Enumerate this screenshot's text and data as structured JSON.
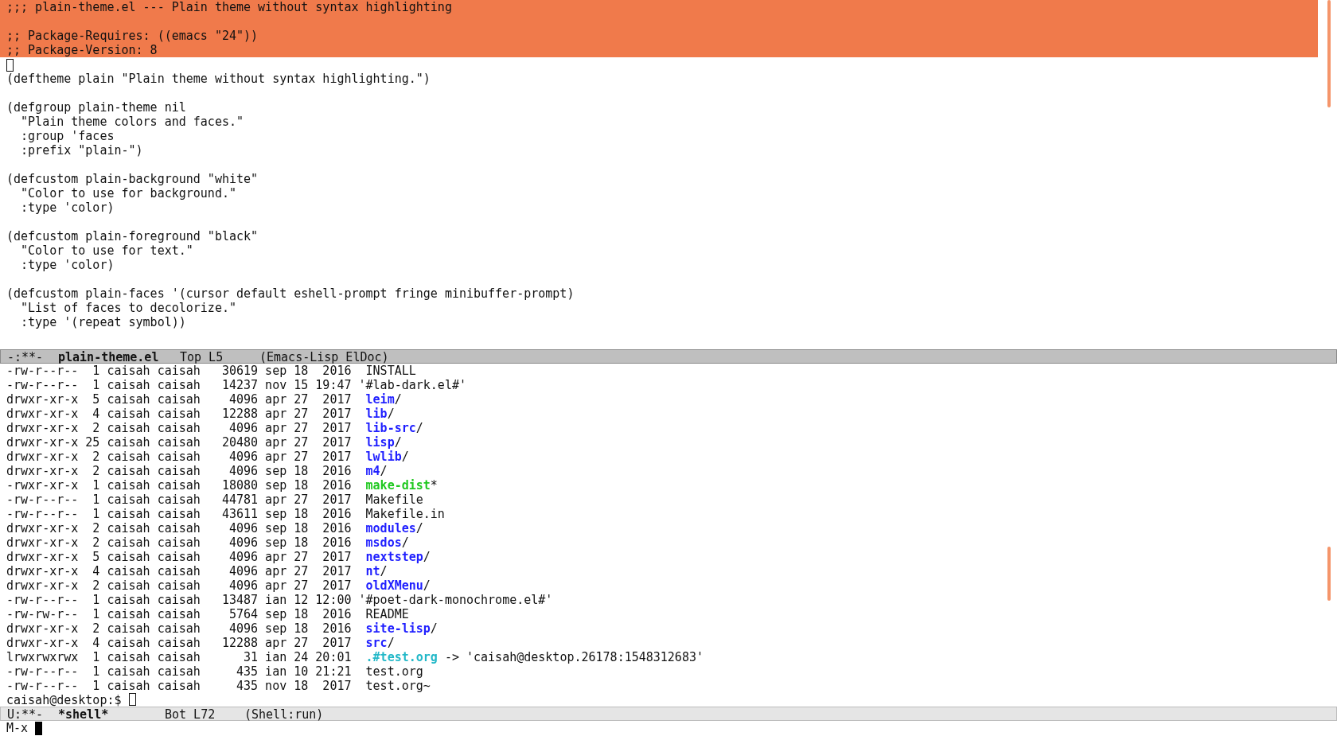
{
  "editor": {
    "lines": [
      {
        "text": ";;; plain-theme.el --- Plain theme without syntax highlighting",
        "highlighted": true,
        "cursor": false
      },
      {
        "highlighted": true,
        "cursor": false
      },
      {
        "text": ";; Package-Requires: ((emacs \"24\"))",
        "highlighted": true,
        "cursor": false
      },
      {
        "text": ";; Package-Version: 8",
        "highlighted": true,
        "cursor": false
      },
      {
        "highlighted": false,
        "cursor": true
      },
      {
        "text": "(deftheme plain \"Plain theme without syntax highlighting.\")",
        "highlighted": false,
        "cursor": false
      },
      {
        "highlighted": false,
        "cursor": false
      },
      {
        "text": "(defgroup plain-theme nil",
        "highlighted": false,
        "cursor": false
      },
      {
        "text": "  \"Plain theme colors and faces.\"",
        "highlighted": false,
        "cursor": false
      },
      {
        "text": "  :group 'faces",
        "highlighted": false,
        "cursor": false
      },
      {
        "text": "  :prefix \"plain-\")",
        "highlighted": false,
        "cursor": false
      },
      {
        "highlighted": false,
        "cursor": false
      },
      {
        "text": "(defcustom plain-background \"white\"",
        "highlighted": false,
        "cursor": false
      },
      {
        "text": "  \"Color to use for background.\"",
        "highlighted": false,
        "cursor": false
      },
      {
        "text": "  :type 'color)",
        "highlighted": false,
        "cursor": false
      },
      {
        "highlighted": false,
        "cursor": false
      },
      {
        "text": "(defcustom plain-foreground \"black\"",
        "highlighted": false,
        "cursor": false
      },
      {
        "text": "  \"Color to use for text.\"",
        "highlighted": false,
        "cursor": false
      },
      {
        "text": "  :type 'color)",
        "highlighted": false,
        "cursor": false
      },
      {
        "highlighted": false,
        "cursor": false
      },
      {
        "text": "(defcustom plain-faces '(cursor default eshell-prompt fringe minibuffer-prompt)",
        "highlighted": false,
        "cursor": false
      },
      {
        "text": "  \"List of faces to decolorize.\"",
        "highlighted": false,
        "cursor": false
      },
      {
        "text": "  :type '(repeat symbol))",
        "highlighted": false,
        "cursor": false
      }
    ],
    "mode_line": {
      "flags": "-:**-",
      "buffer": "plain-theme.el",
      "position": "Top L5",
      "mode": "(Emacs-Lisp ElDoc)",
      "active": true
    }
  },
  "shell": {
    "rows": [
      {
        "info": "-rw-r--r--  1 caisah caisah   30619 sep 18  2016  ",
        "name": "INSTALL",
        "kind": "file"
      },
      {
        "info": "-rw-r--r--  1 caisah caisah   14237 nov 15 19:47 ",
        "name": "'#lab-dark.el#'",
        "kind": "file"
      },
      {
        "info": "drwxr-xr-x  5 caisah caisah    4096 apr 27  2017  ",
        "name": "leim",
        "kind": "dir",
        "suffix": "/"
      },
      {
        "info": "drwxr-xr-x  4 caisah caisah   12288 apr 27  2017  ",
        "name": "lib",
        "kind": "dir",
        "suffix": "/"
      },
      {
        "info": "drwxr-xr-x  2 caisah caisah    4096 apr 27  2017  ",
        "name": "lib-src",
        "kind": "dir",
        "suffix": "/"
      },
      {
        "info": "drwxr-xr-x 25 caisah caisah   20480 apr 27  2017  ",
        "name": "lisp",
        "kind": "dir",
        "suffix": "/"
      },
      {
        "info": "drwxr-xr-x  2 caisah caisah    4096 apr 27  2017  ",
        "name": "lwlib",
        "kind": "dir",
        "suffix": "/"
      },
      {
        "info": "drwxr-xr-x  2 caisah caisah    4096 sep 18  2016  ",
        "name": "m4",
        "kind": "dir",
        "suffix": "/"
      },
      {
        "info": "-rwxr-xr-x  1 caisah caisah   18080 sep 18  2016  ",
        "name": "make-dist",
        "kind": "exec",
        "suffix": "*"
      },
      {
        "info": "-rw-r--r--  1 caisah caisah   44781 apr 27  2017  ",
        "name": "Makefile",
        "kind": "file"
      },
      {
        "info": "-rw-r--r--  1 caisah caisah   43611 sep 18  2016  ",
        "name": "Makefile.in",
        "kind": "file"
      },
      {
        "info": "drwxr-xr-x  2 caisah caisah    4096 sep 18  2016  ",
        "name": "modules",
        "kind": "dir",
        "suffix": "/"
      },
      {
        "info": "drwxr-xr-x  2 caisah caisah    4096 sep 18  2016  ",
        "name": "msdos",
        "kind": "dir",
        "suffix": "/"
      },
      {
        "info": "drwxr-xr-x  5 caisah caisah    4096 apr 27  2017  ",
        "name": "nextstep",
        "kind": "dir",
        "suffix": "/"
      },
      {
        "info": "drwxr-xr-x  4 caisah caisah    4096 apr 27  2017  ",
        "name": "nt",
        "kind": "dir",
        "suffix": "/"
      },
      {
        "info": "drwxr-xr-x  2 caisah caisah    4096 apr 27  2017  ",
        "name": "oldXMenu",
        "kind": "dir",
        "suffix": "/"
      },
      {
        "info": "-rw-r--r--  1 caisah caisah   13487 ian 12 12:00 ",
        "name": "'#poet-dark-monochrome.el#'",
        "kind": "file"
      },
      {
        "info": "-rw-rw-r--  1 caisah caisah    5764 sep 18  2016  ",
        "name": "README",
        "kind": "file"
      },
      {
        "info": "drwxr-xr-x  2 caisah caisah    4096 sep 18  2016  ",
        "name": "site-lisp",
        "kind": "dir",
        "suffix": "/"
      },
      {
        "info": "drwxr-xr-x  4 caisah caisah   12288 apr 27  2017  ",
        "name": "src",
        "kind": "dir",
        "suffix": "/"
      },
      {
        "info": "lrwxrwxrwx  1 caisah caisah      31 ian 24 20:01  ",
        "name": ".#test.org",
        "kind": "link",
        "suffix": " -> 'caisah@desktop.26178:1548312683'"
      },
      {
        "info": "-rw-r--r--  1 caisah caisah     435 ian 10 21:21  ",
        "name": "test.org",
        "kind": "file"
      },
      {
        "info": "-rw-r--r--  1 caisah caisah     435 nov 18  2017  ",
        "name": "test.org~",
        "kind": "file"
      }
    ],
    "prompt": "caisah@desktop:$",
    "mode_line": {
      "flags": "U:**-",
      "buffer": "*shell*",
      "position": "Bot L72",
      "mode": "(Shell:run)",
      "active": false
    }
  },
  "minibuffer": {
    "text": "M-x"
  }
}
